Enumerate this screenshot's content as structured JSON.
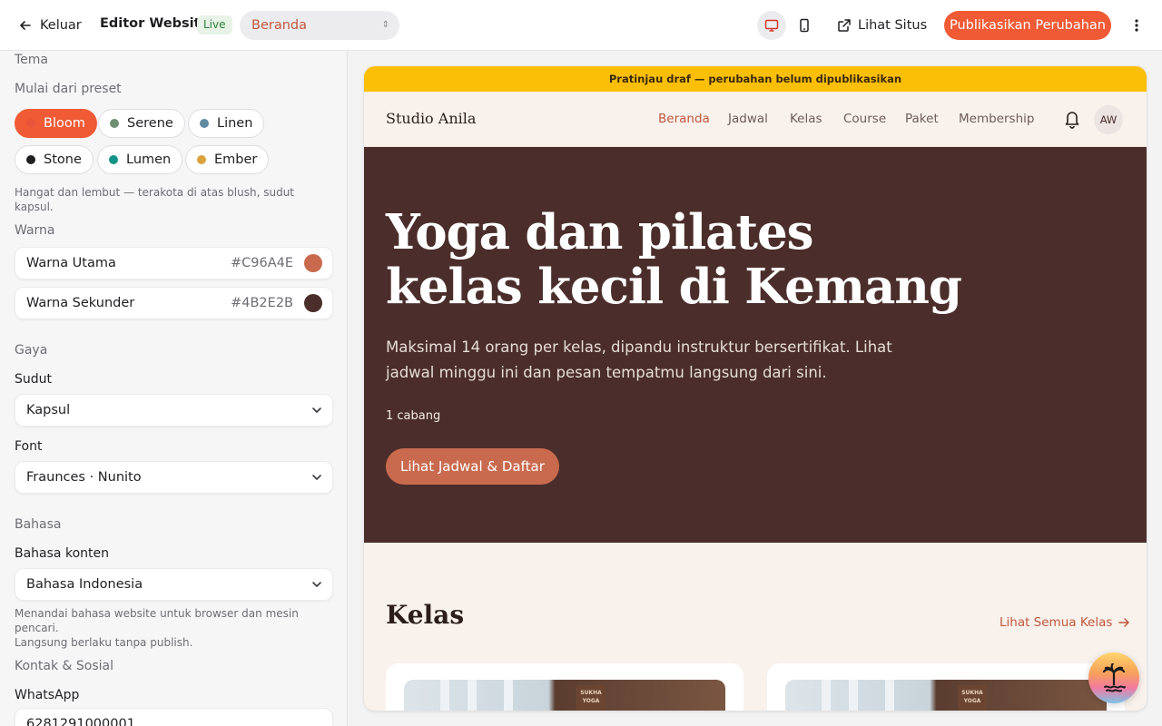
{
  "topbar": {
    "back_label": "Keluar",
    "title": "Editor Website",
    "status_badge": "Live",
    "page_select": "Beranda",
    "view_site_label": "Lihat Situs",
    "publish_label": "Publikasikan Perubahan"
  },
  "sidebar": {
    "theme": {
      "section": "Tema",
      "preset_label": "Mulai dari preset",
      "presets": [
        {
          "label": "Bloom",
          "color": "#F07A58",
          "active": true
        },
        {
          "label": "Serene",
          "color": "#6E8F72"
        },
        {
          "label": "Linen",
          "color": "#5F8AA0"
        },
        {
          "label": "Stone",
          "color": "#1F1F22"
        },
        {
          "label": "Lumen",
          "color": "#119487"
        },
        {
          "label": "Ember",
          "color": "#D9A23C"
        }
      ],
      "preset_hint": "Hangat dan lembut — terakota di atas blush, sudut kapsul."
    },
    "colors": {
      "section": "Warna",
      "primary_label": "Warna Utama",
      "primary_hex": "#C96A4E",
      "secondary_label": "Warna Sekunder",
      "secondary_hex": "#4B2E2B"
    },
    "style": {
      "section": "Gaya",
      "corner_label": "Sudut",
      "corner_value": "Kapsul",
      "font_label": "Font",
      "font_value": "Fraunces · Nunito"
    },
    "language": {
      "section": "Bahasa",
      "content_label": "Bahasa konten",
      "content_value": "Bahasa Indonesia",
      "hint_line1": "Menandai bahasa website untuk browser dan mesin pencari.",
      "hint_line2": "Langsung berlaku tanpa publish."
    },
    "contact": {
      "section": "Kontak & Sosial",
      "whatsapp_label": "WhatsApp",
      "whatsapp_value": "6281291000001"
    }
  },
  "preview": {
    "draft_banner": "Pratinjau draf — perubahan belum dipublikasikan",
    "brand": "Studio Anila",
    "nav": [
      "Beranda",
      "Jadwal",
      "Kelas",
      "Course",
      "Paket",
      "Membership"
    ],
    "avatar_initials": "AW",
    "hero": {
      "title_line1": "Yoga dan pilates",
      "title_line2": "kelas kecil di Kemang",
      "desc_line1": "Maksimal 14 orang per kelas, dipandu instruktur bersertifikat. Lihat",
      "desc_line2": "jadwal minggu ini dan pesan tempatmu langsung dari sini.",
      "branches": "1 cabang",
      "cta": "Lihat Jadwal & Daftar"
    },
    "classes": {
      "heading": "Kelas",
      "see_all": "Lihat Semua Kelas",
      "sign_text_line1": "SUKHA",
      "sign_text_line2": "YOGA"
    }
  }
}
